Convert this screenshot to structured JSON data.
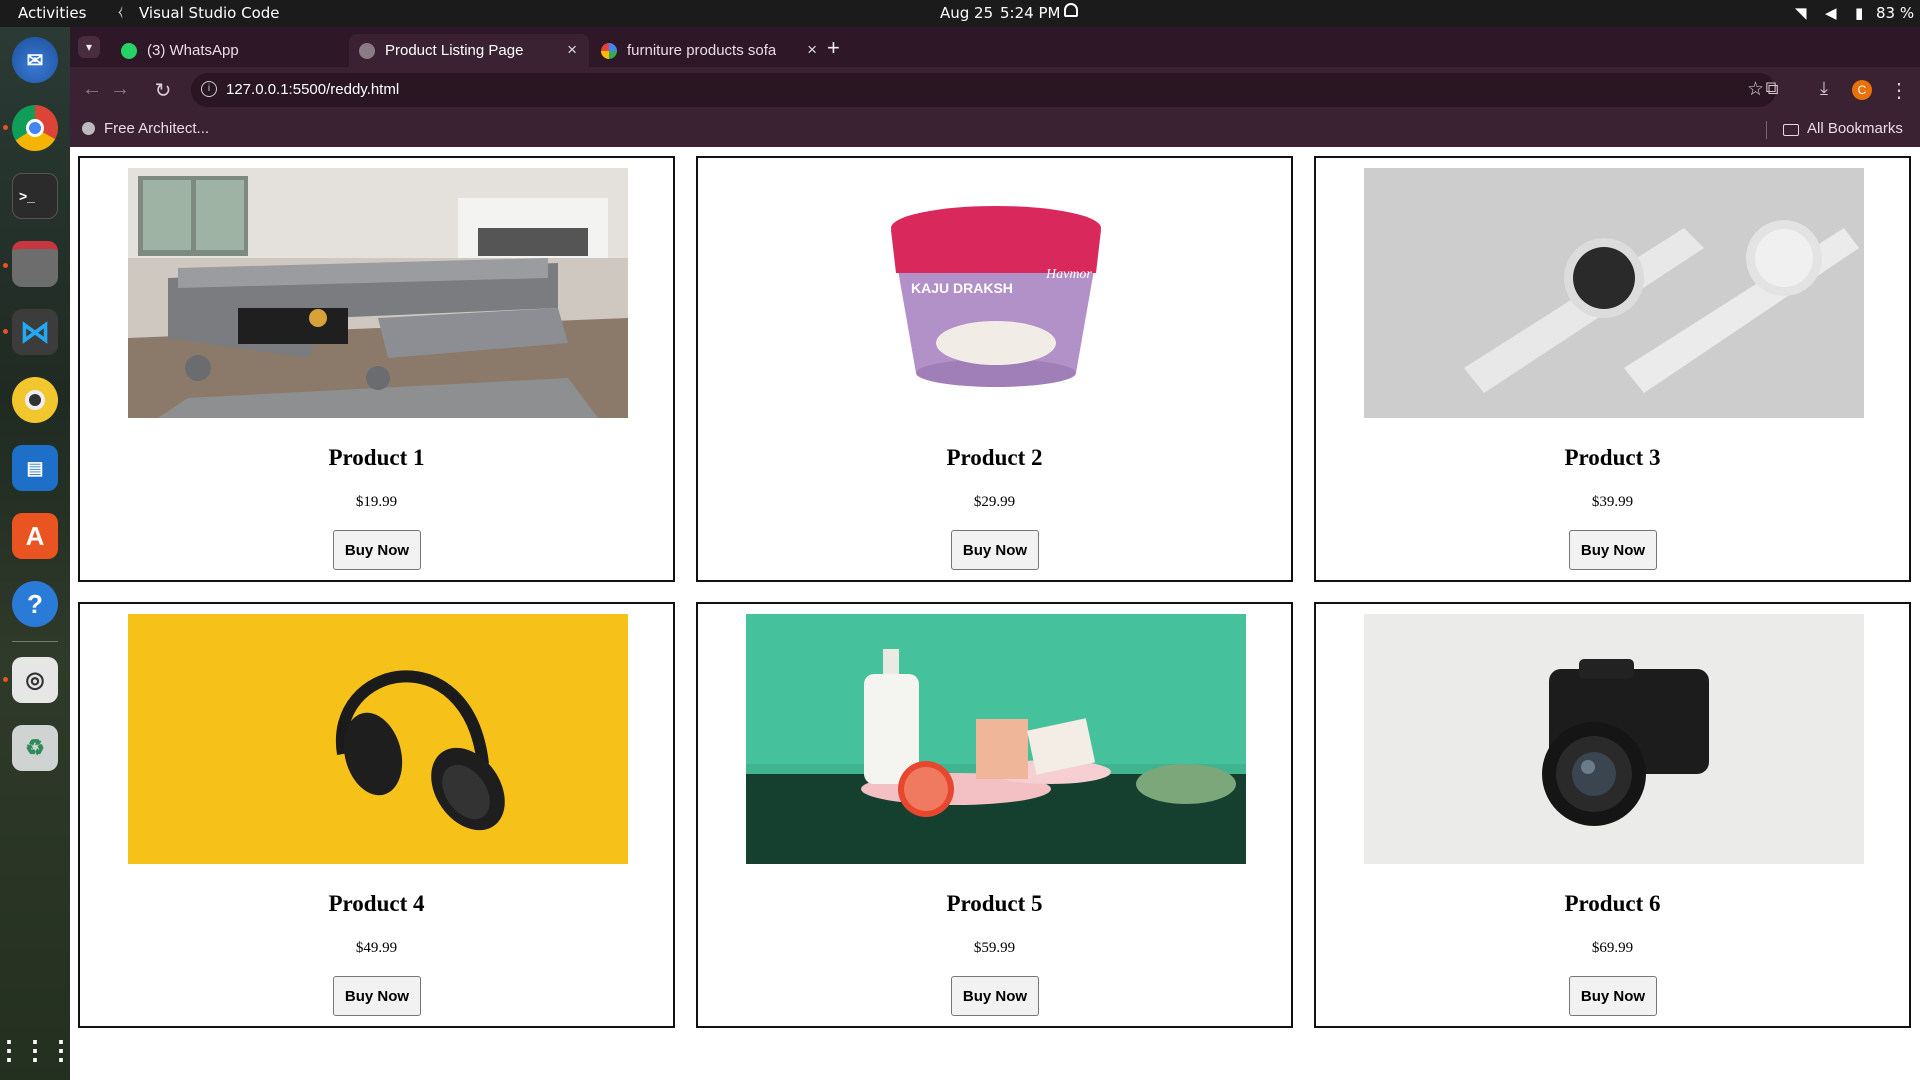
{
  "os": {
    "activities": "Activities",
    "focused_app": "Visual Studio Code",
    "date": "Aug 25",
    "time": "5:24 PM",
    "battery": "83 %"
  },
  "browser": {
    "tabs": [
      {
        "label": "(3) WhatsApp"
      },
      {
        "label": "Product Listing Page"
      },
      {
        "label": "furniture products sofa"
      }
    ],
    "url": "127.0.0.1:5500/reddy.html",
    "bookmarks": {
      "left": "Free Architect...",
      "right": "All Bookmarks"
    }
  },
  "products": [
    {
      "name": "Product 1",
      "price": "$19.99",
      "button": "Buy Now"
    },
    {
      "name": "Product 2",
      "price": "$29.99",
      "button": "Buy Now"
    },
    {
      "name": "Product 3",
      "price": "$39.99",
      "button": "Buy Now"
    },
    {
      "name": "Product 4",
      "price": "$49.99",
      "button": "Buy Now"
    },
    {
      "name": "Product 5",
      "price": "$59.99",
      "button": "Buy Now"
    },
    {
      "name": "Product 6",
      "price": "$69.99",
      "button": "Buy Now"
    }
  ],
  "image_labels": {
    "ice_cream_brand": "Havmor",
    "ice_cream_flavour": "KAJU DRAKSH"
  },
  "colors": {
    "topbar": "#1b1b1b",
    "chrome_frame": "#3b2233",
    "accent": "#e95420"
  }
}
